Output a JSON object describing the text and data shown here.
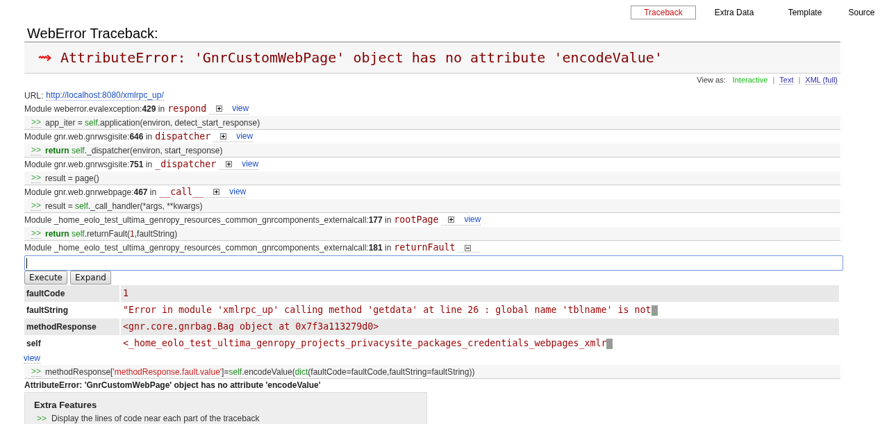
{
  "tabs": [
    {
      "label": "Traceback",
      "selected": true
    },
    {
      "label": "Extra Data",
      "selected": false
    },
    {
      "label": "Template",
      "selected": false
    },
    {
      "label": "Source",
      "selected": false
    }
  ],
  "title": "WebError Traceback:",
  "error": "AttributeError: 'GnrCustomWebPage' object has no attribute 'encodeValue'",
  "view_as": {
    "label": "View as:",
    "items": [
      {
        "kind": "option",
        "label": "Interactive",
        "selected": true
      },
      {
        "kind": "separator",
        "label": "|"
      },
      {
        "kind": "option",
        "label": "Text",
        "selected": false
      },
      {
        "kind": "separator",
        "label": "|"
      },
      {
        "kind": "option",
        "label": "XML (full)",
        "selected": false
      }
    ]
  },
  "url": {
    "label": "URL:",
    "link": "http://localhost:8080/xmlrpc_up/"
  },
  "frames": [
    {
      "location": "Module weberror.evalexception:**429** in",
      "function": "respond",
      "expanded": false,
      "view_link": "view",
      "code": {
        "prompt": ">>",
        "tokens": [
          {
            "kind": "text",
            "text": "app_iter = "
          },
          {
            "kind": "name",
            "text": "self"
          },
          {
            "kind": "text",
            "text": ".application(environ, detect_start_response)"
          }
        ]
      }
    },
    {
      "location": "Module gnr.web.gnrwsgisite:**646** in",
      "function": "dispatcher",
      "expanded": false,
      "view_link": "view",
      "code": {
        "prompt": ">>",
        "tokens": [
          {
            "kind": "keyword",
            "text": "return "
          },
          {
            "kind": "name",
            "text": "self"
          },
          {
            "kind": "text",
            "text": "._dispatcher(environ, start_response)"
          }
        ]
      }
    },
    {
      "location": "Module gnr.web.gnrwsgisite:**751** in",
      "function": "_dispatcher",
      "expanded": false,
      "view_link": "view",
      "code": {
        "prompt": ">>",
        "tokens": [
          {
            "kind": "text",
            "text": "result = page()"
          }
        ]
      }
    },
    {
      "location": "Module gnr.web.gnrwebpage:**467** in",
      "function": "__call__",
      "expanded": false,
      "view_link": "view",
      "code": {
        "prompt": ">>",
        "tokens": [
          {
            "kind": "text",
            "text": "result = "
          },
          {
            "kind": "name",
            "text": "self"
          },
          {
            "kind": "text",
            "text": "._call_handler(*args, **kwargs)"
          }
        ]
      }
    },
    {
      "location": "Module _home_eolo_test_ultima_genropy_resources_common_gnrcomponents_externalcall:**177** in",
      "function": "rootPage",
      "expanded": false,
      "view_link": "view",
      "code": {
        "prompt": ">>",
        "tokens": [
          {
            "kind": "keyword",
            "text": "return "
          },
          {
            "kind": "name",
            "text": "self"
          },
          {
            "kind": "text",
            "text": ".returnFault("
          },
          {
            "kind": "number",
            "text": "1"
          },
          {
            "kind": "text",
            "text": ",faultString)"
          }
        ]
      }
    },
    {
      "location": "Module _home_eolo_test_ultima_genropy_resources_common_gnrcomponents_externalcall:**181** in",
      "function": "returnFault",
      "expanded": true,
      "view_link": "view",
      "console": {
        "buttons": [
          "Execute",
          "Expand"
        ],
        "variables": [
          {
            "name": "faultCode",
            "value": "1",
            "truncated": false
          },
          {
            "name": "faultString",
            "value": "\"Error in module 'xmlrpc_up' calling method 'getdata' at line 26 : global name 'tblname' is not",
            "truncated": true
          },
          {
            "name": "methodResponse",
            "value": "<gnr.core.gnrbag.Bag object at 0x7f3a113279d0>",
            "truncated": false
          },
          {
            "name": "self",
            "value": "<_home_eolo_test_ultima_genropy_projects_privacysite_packages_credentials_webpages_xmlr",
            "truncated": true
          }
        ]
      },
      "code": {
        "prompt": ">>",
        "tokens": [
          {
            "kind": "text",
            "text": "methodResponse["
          },
          {
            "kind": "string",
            "text": "'methodResponse.fault.value'"
          },
          {
            "kind": "text",
            "text": "]="
          },
          {
            "kind": "name",
            "text": "self"
          },
          {
            "kind": "text",
            "text": ".encodeValue("
          },
          {
            "kind": "builtin",
            "text": "dict"
          },
          {
            "kind": "text",
            "text": "(faultCode=faultCode,faultString=faultString))"
          }
        ]
      }
    }
  ],
  "exception": "AttributeError: 'GnrCustomWebPage' object has no attribute 'encodeValue'",
  "extra_features": {
    "title": "Extra Features",
    "items": [
      {
        "prompt": ">>",
        "text": "Display the lines of code near each part of the traceback"
      }
    ]
  }
}
